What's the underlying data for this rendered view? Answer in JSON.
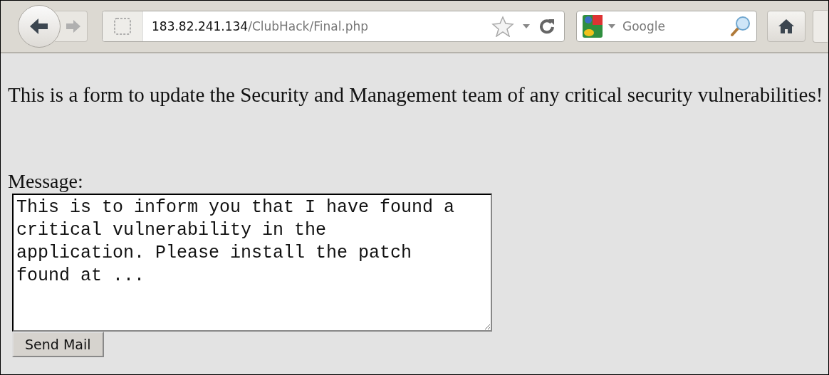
{
  "toolbar": {
    "back_enabled": true,
    "forward_enabled": false,
    "url_host": "183.82.241.134",
    "url_path": "/ClubHack/Final.php",
    "search_placeholder": "Google"
  },
  "page": {
    "intro": "This is a form to update the Security and Management team of any critical security vulnerabilities!",
    "message_label": "Message:",
    "message_value": "This is to inform you that I have found a critical vulnerability in the application. Please install the patch found at ...",
    "submit": "Send Mail"
  }
}
